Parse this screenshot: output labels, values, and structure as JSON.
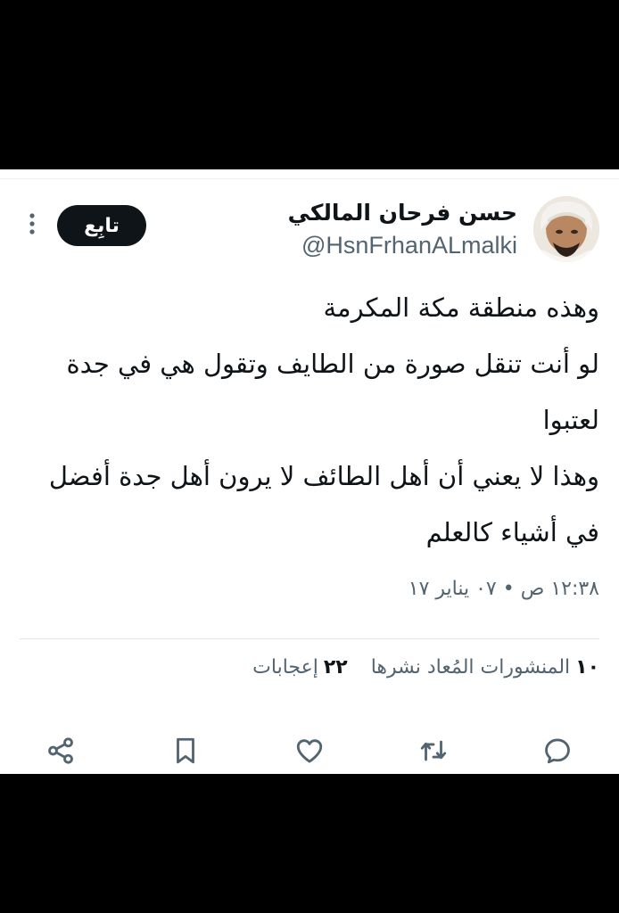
{
  "author": {
    "name": "حسن فرحان المالكي",
    "handle": "@HsnFrhanALmalki",
    "follow_label": "تابِع"
  },
  "tweet": {
    "lines": [
      "وهذه منطقة مكة المكرمة",
      "لو أنت تنقل صورة من الطايف وتقول هي في جدة",
      "لعتبوا",
      "وهذا لا يعني أن أهل الطائف لا يرون أهل جدة أفضل",
      "في أشياء كالعلم"
    ],
    "timestamp": "١٢:٣٨ ص • ٠٧ يناير ١٧"
  },
  "stats": {
    "reposts_count": "١٠",
    "reposts_label": "المنشورات المُعاد نشرها",
    "likes_count": "٢٢",
    "likes_label": "إعجابات"
  },
  "actions": {
    "icons": [
      "reply-icon",
      "repost-icon",
      "like-icon",
      "bookmark-icon",
      "share-icon"
    ]
  },
  "colors": {
    "text": "#0f1419",
    "secondary": "#536471",
    "background": "#ffffff"
  }
}
